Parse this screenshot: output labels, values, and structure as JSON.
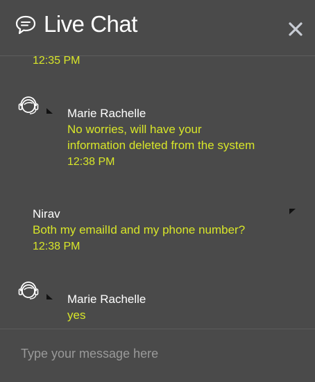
{
  "header": {
    "title": "Live Chat"
  },
  "messages": [
    {
      "time": "12:35 PM"
    },
    {
      "sender": "Marie Rachelle",
      "text_lines": [
        "No worries, will have your",
        "information deleted from the system"
      ],
      "time": "12:38 PM"
    },
    {
      "sender": "Nirav",
      "text_lines": [
        "Both my emailId and my phone number?"
      ],
      "time": "12:38 PM"
    },
    {
      "sender": "Marie Rachelle",
      "text_lines": [
        "yes"
      ]
    }
  ],
  "composer": {
    "placeholder": "Type your message here"
  },
  "colors": {
    "background": "#4a4a4a",
    "accent_text": "#d8e629",
    "sender_text": "#ffffff"
  },
  "icons": [
    "chat-bubble-icon",
    "close-icon",
    "agent-headset-icon"
  ]
}
